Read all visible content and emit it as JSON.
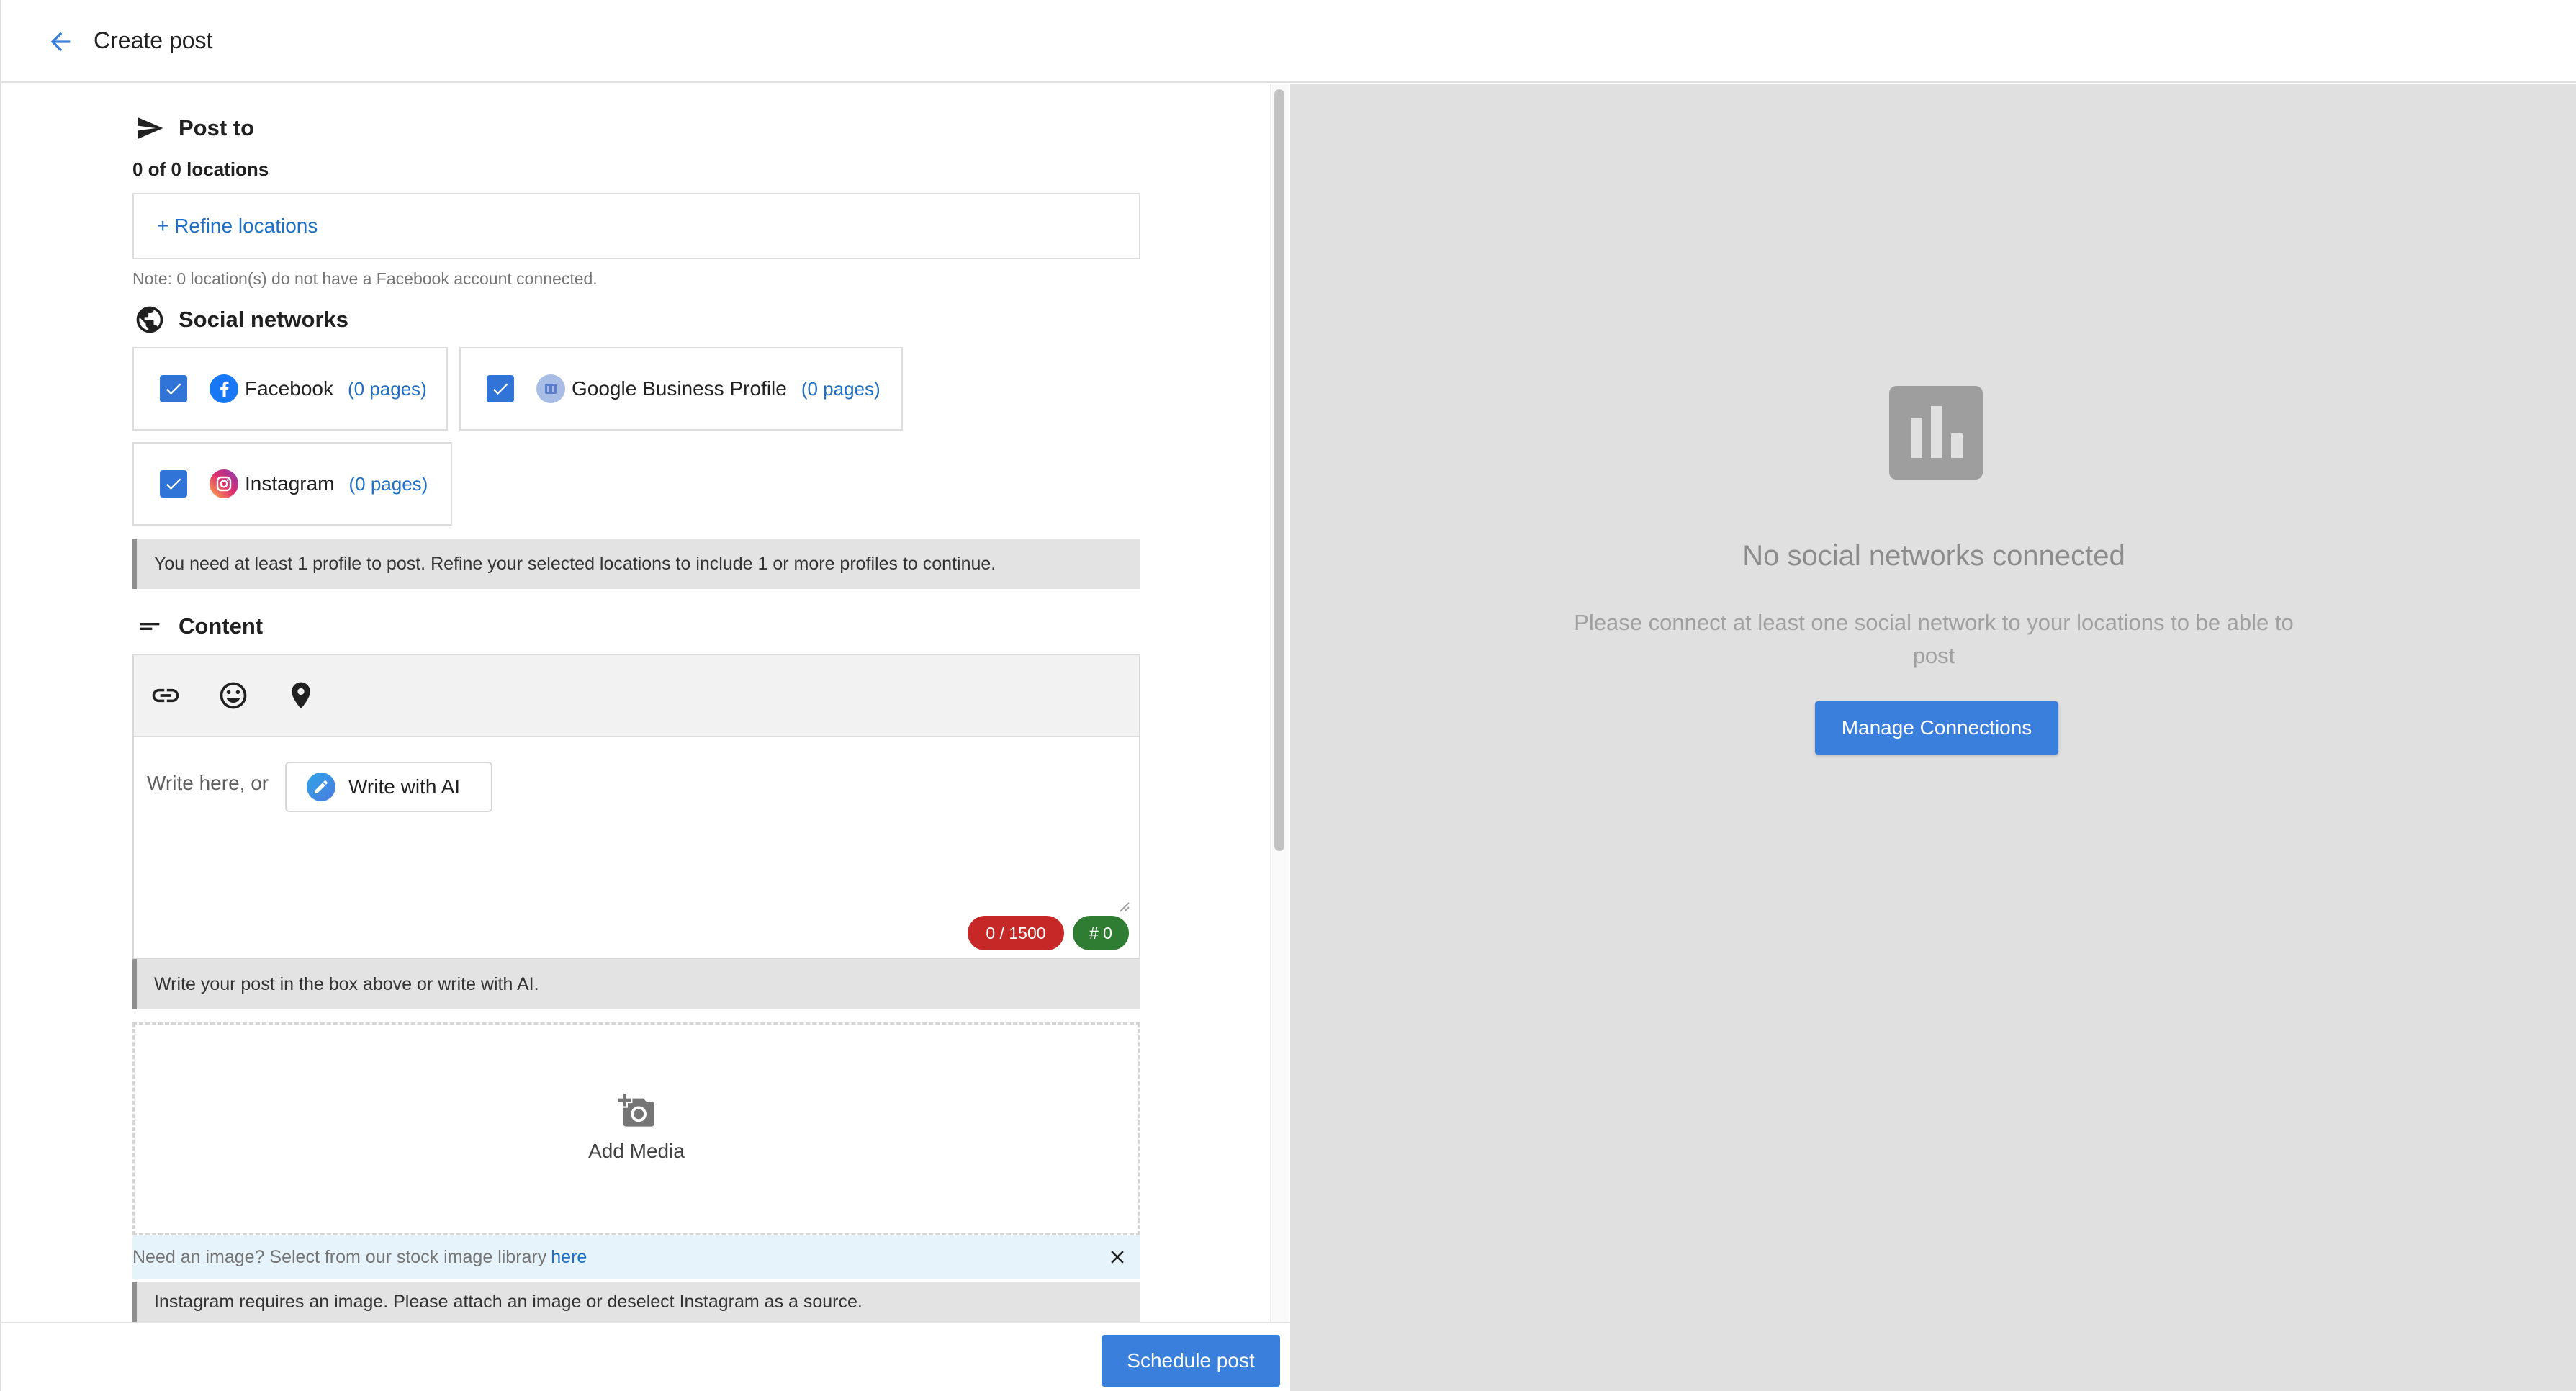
{
  "header": {
    "title": "Create post"
  },
  "post_to": {
    "title": "Post to",
    "locations_count": "0 of 0 locations",
    "refine_link": "+ Refine locations",
    "note": "Note: 0 location(s) do not have a Facebook account connected."
  },
  "social_networks": {
    "title": "Social networks",
    "items": [
      {
        "name": "Facebook",
        "pages": "(0 pages)",
        "checked": true
      },
      {
        "name": "Google Business Profile",
        "pages": "(0 pages)",
        "checked": true
      },
      {
        "name": "Instagram",
        "pages": "(0 pages)",
        "checked": true
      }
    ],
    "warning": "You need at least 1 profile to post. Refine your selected locations to include 1 or more profiles to continue."
  },
  "content": {
    "title": "Content",
    "toolbar_icons": [
      "link-icon",
      "emoji-icon",
      "location-pin-icon"
    ],
    "placeholder": "Write here, or",
    "ai_button": "Write with AI",
    "char_counter": "0 / 1500",
    "hashtag_counter": "# 0",
    "hint": "Write your post in the box above or write with AI.",
    "add_media": "Add Media",
    "stock_prompt": "Need an image? Select from our stock image library",
    "stock_link": "here",
    "instagram_warning": "Instagram requires an image. Please attach an image or deselect Instagram as a source."
  },
  "footer": {
    "schedule_button": "Schedule post"
  },
  "preview": {
    "empty_title": "No social networks connected",
    "empty_description": "Please connect at least one social network to your locations to be able to post",
    "manage_button": "Manage Connections"
  },
  "colors": {
    "accent": "#3a7fdc",
    "link": "#1f6fc5",
    "counter_red": "#c62828",
    "counter_green": "#2e7d32",
    "preview_bg": "#e0e0e0"
  }
}
